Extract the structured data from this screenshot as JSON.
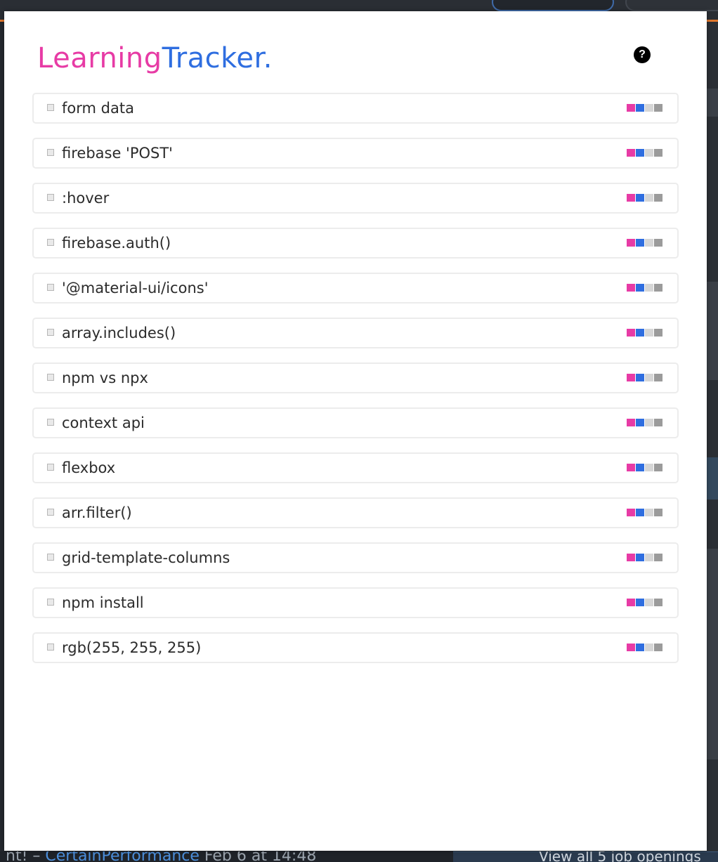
{
  "app": {
    "logo_part1": "Learning",
    "logo_part2": "Tracker.",
    "help_label": "?"
  },
  "colors": {
    "brand_pink": "#e73ba5",
    "brand_blue": "#2f6ee0",
    "level_empty": "#d6d6d6",
    "level_grey": "#9b9b9b"
  },
  "items": [
    {
      "label": "form data",
      "level_colors": [
        "#e73ba5",
        "#2f6ee0",
        "#d6d6d6",
        "#9b9b9b"
      ]
    },
    {
      "label": "firebase 'POST'",
      "level_colors": [
        "#e73ba5",
        "#2f6ee0",
        "#d6d6d6",
        "#9b9b9b"
      ]
    },
    {
      "label": ":hover",
      "level_colors": [
        "#e73ba5",
        "#2f6ee0",
        "#d6d6d6",
        "#9b9b9b"
      ]
    },
    {
      "label": "firebase.auth()",
      "level_colors": [
        "#e73ba5",
        "#2f6ee0",
        "#d6d6d6",
        "#9b9b9b"
      ]
    },
    {
      "label": "'@material-ui/icons'",
      "level_colors": [
        "#e73ba5",
        "#2f6ee0",
        "#d6d6d6",
        "#9b9b9b"
      ]
    },
    {
      "label": "array.includes()",
      "level_colors": [
        "#e73ba5",
        "#2f6ee0",
        "#d6d6d6",
        "#9b9b9b"
      ]
    },
    {
      "label": "npm vs npx",
      "level_colors": [
        "#e73ba5",
        "#2f6ee0",
        "#d6d6d6",
        "#9b9b9b"
      ]
    },
    {
      "label": "context api",
      "level_colors": [
        "#e73ba5",
        "#2f6ee0",
        "#d6d6d6",
        "#9b9b9b"
      ]
    },
    {
      "label": "flexbox",
      "level_colors": [
        "#e73ba5",
        "#2f6ee0",
        "#d6d6d6",
        "#9b9b9b"
      ]
    },
    {
      "label": "arr.filter()",
      "level_colors": [
        "#e73ba5",
        "#2f6ee0",
        "#d6d6d6",
        "#9b9b9b"
      ]
    },
    {
      "label": "grid-template-columns",
      "level_colors": [
        "#e73ba5",
        "#2f6ee0",
        "#d6d6d6",
        "#9b9b9b"
      ]
    },
    {
      "label": "npm install",
      "level_colors": [
        "#e73ba5",
        "#2f6ee0",
        "#d6d6d6",
        "#9b9b9b"
      ]
    },
    {
      "label": "rgb(255, 255, 255)",
      "level_colors": [
        "#e73ba5",
        "#2f6ee0",
        "#d6d6d6",
        "#9b9b9b"
      ]
    }
  ],
  "background": {
    "bottom_left_prefix": "nt! – ",
    "bottom_left_link": "CertainPerformance",
    "bottom_left_suffix": " Feb 6 at 14:48",
    "bottom_right_text": "View all 5 job openings"
  }
}
